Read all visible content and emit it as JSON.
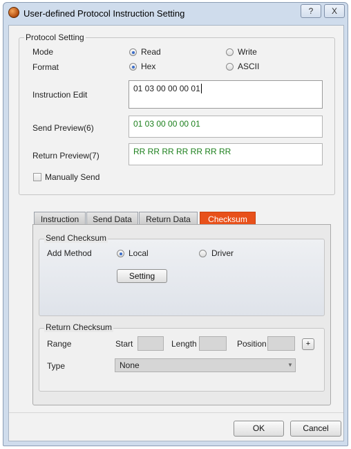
{
  "window": {
    "title": "User-defined Protocol Instruction Setting",
    "help_glyph": "?",
    "close_glyph": "X"
  },
  "protocol_setting": {
    "group_title": "Protocol Setting",
    "mode_label": "Mode",
    "mode_options": [
      {
        "label": "Read",
        "selected": true
      },
      {
        "label": "Write",
        "selected": false
      }
    ],
    "format_label": "Format",
    "format_options": [
      {
        "label": "Hex",
        "selected": true
      },
      {
        "label": "ASCII",
        "selected": false
      }
    ],
    "instruction_edit_label": "Instruction Edit",
    "instruction_edit_value": "01 03 00 00 00 01",
    "send_preview_label": "Send Preview(6)",
    "send_preview_value": "01 03 00 00 00 01",
    "return_preview_label": "Return Preview(7)",
    "return_preview_value": "RR RR RR RR RR RR RR",
    "manually_send_label": "Manually Send",
    "manually_send_checked": false
  },
  "tabs": [
    {
      "label": "Instruction",
      "active": false
    },
    {
      "label": "Send Data",
      "active": false
    },
    {
      "label": "Return Data",
      "active": false
    },
    {
      "label": "Checksum",
      "active": true
    }
  ],
  "send_checksum": {
    "group_title": "Send Checksum",
    "add_method_label": "Add Method",
    "options": [
      {
        "label": "Local",
        "selected": true
      },
      {
        "label": "Driver",
        "selected": false
      }
    ],
    "setting_button": "Setting"
  },
  "return_checksum": {
    "group_title": "Return Checksum",
    "range_label": "Range",
    "start_label": "Start",
    "length_label": "Length",
    "position_label": "Position",
    "plus_button": "+",
    "type_label": "Type",
    "type_value": "None"
  },
  "footer": {
    "ok_button": "OK",
    "cancel_button": "Cancel"
  },
  "colors": {
    "active_tab": "#e8511b",
    "preview_text": "#1b7f1b",
    "title_bar": "#cfdcec"
  }
}
